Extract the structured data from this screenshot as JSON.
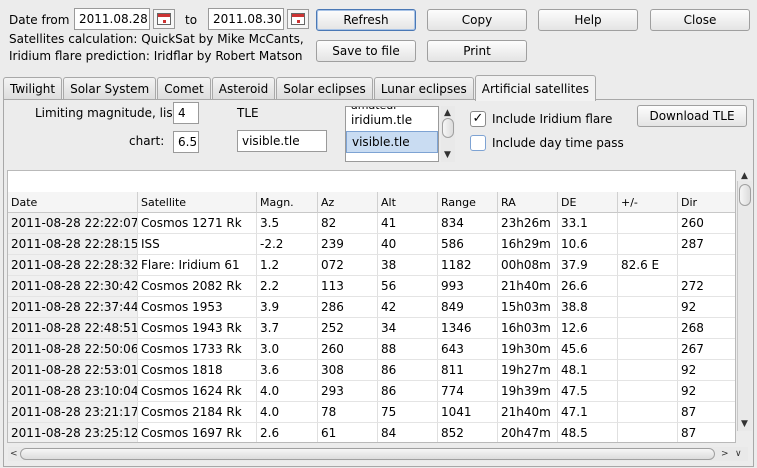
{
  "header": {
    "date_from_label": "Date from",
    "date_from": "2011.08.28",
    "to_label": "to",
    "date_to": "2011.08.30",
    "credit_line1": "Satellites calculation: QuickSat by Mike McCants,",
    "credit_line2": "Iridium flare prediction: Iridflar by Robert Matson"
  },
  "buttons": {
    "refresh": "Refresh",
    "copy": "Copy",
    "help": "Help",
    "close": "Close",
    "save_to_file": "Save to file",
    "print": "Print",
    "download_tle": "Download TLE"
  },
  "tabs": [
    {
      "label": "Twilight"
    },
    {
      "label": "Solar System"
    },
    {
      "label": "Comet"
    },
    {
      "label": "Asteroid"
    },
    {
      "label": "Solar eclipses"
    },
    {
      "label": "Lunar eclipses"
    },
    {
      "label": "Artificial satellites",
      "active": true
    }
  ],
  "options": {
    "limiting_mag_list_label": "Limiting magnitude, list:",
    "limiting_mag_list": "4",
    "chart_label": "chart:",
    "chart_value": "6.5",
    "tle_label": "TLE",
    "tle_value": "visible.tle",
    "tle_list": [
      "amateur",
      "iridium.tle",
      "visible.tle"
    ],
    "include_iridium_label": "Include Iridium flare",
    "include_iridium_checked": true,
    "include_day_label": "Include day time pass",
    "include_day_checked": false
  },
  "table": {
    "columns": [
      "Date",
      "Satellite",
      "Magn.",
      "Az",
      "Alt",
      "Range",
      "RA",
      "DE",
      "+/-",
      "Dir"
    ],
    "rows": [
      [
        "2011-08-28 22:22:07",
        "Cosmos 1271 Rk",
        "3.5",
        "82",
        "41",
        "834",
        "23h26m",
        "33.1",
        "",
        "260"
      ],
      [
        "2011-08-28 22:28:15",
        "ISS",
        "-2.2",
        "239",
        "40",
        "586",
        "16h29m",
        "10.6",
        "",
        "287"
      ],
      [
        "2011-08-28 22:28:32",
        "Flare: Iridium 61",
        "1.2",
        "072",
        "38",
        "1182",
        "00h08m",
        "37.9",
        "82.6 E",
        ""
      ],
      [
        "2011-08-28 22:30:42",
        "Cosmos 2082 Rk",
        "2.2",
        "113",
        "56",
        "993",
        "21h40m",
        "26.6",
        "",
        "272"
      ],
      [
        "2011-08-28 22:37:44",
        "Cosmos 1953",
        "3.9",
        "286",
        "42",
        "849",
        "15h03m",
        "38.8",
        "",
        "92"
      ],
      [
        "2011-08-28 22:48:51",
        "Cosmos 1943 Rk",
        "3.7",
        "252",
        "34",
        "1346",
        "16h03m",
        "12.6",
        "",
        "268"
      ],
      [
        "2011-08-28 22:50:06",
        "Cosmos 1733 Rk",
        "3.0",
        "260",
        "88",
        "643",
        "19h30m",
        "45.6",
        "",
        "267"
      ],
      [
        "2011-08-28 22:53:01",
        "Cosmos 1818",
        "3.6",
        "308",
        "86",
        "811",
        "19h27m",
        "48.1",
        "",
        "92"
      ],
      [
        "2011-08-28 23:10:04",
        "Cosmos 1624 Rk",
        "4.0",
        "293",
        "86",
        "774",
        "19h39m",
        "47.5",
        "",
        "92"
      ],
      [
        "2011-08-28 23:21:17",
        "Cosmos 2184 Rk",
        "4.0",
        "78",
        "75",
        "1041",
        "21h40m",
        "47.1",
        "",
        "87"
      ],
      [
        "2011-08-28 23:25:12",
        "Cosmos 1697 Rk",
        "2.6",
        "61",
        "84",
        "852",
        "20h47m",
        "48.5",
        "",
        "87"
      ]
    ]
  }
}
